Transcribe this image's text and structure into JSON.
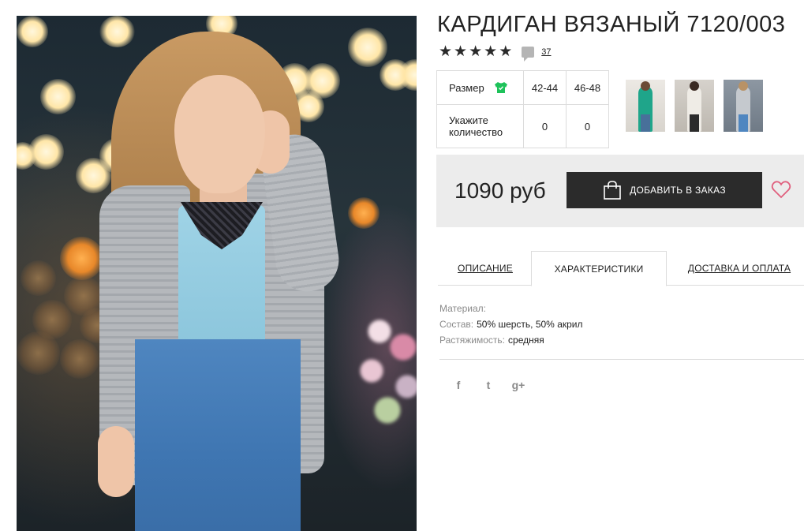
{
  "product": {
    "title": "КАРДИГАН ВЯЗАНЫЙ 7120/003",
    "rating_stars": 5,
    "review_count": "37",
    "price": "1090 руб"
  },
  "size_table": {
    "size_label": "Размер",
    "sizes": [
      "42-44",
      "46-48"
    ],
    "quantity_label": "Укажите количество",
    "quantities": [
      "0",
      "0"
    ]
  },
  "actions": {
    "add_to_order": "ДОБАВИТЬ В ЗАКАЗ"
  },
  "tabs": [
    {
      "label": "ОПИСАНИЕ",
      "active": false
    },
    {
      "label": "ХАРАКТЕРИСТИКИ",
      "active": true
    },
    {
      "label": "ДОСТАВКА И ОПЛАТА",
      "active": false
    }
  ],
  "specs": [
    {
      "key": "Материал:",
      "value": ""
    },
    {
      "key": "Состав:",
      "value": "50% шерсть, 50% акрил"
    },
    {
      "key": "Растяжимость:",
      "value": "средняя"
    }
  ],
  "social": {
    "facebook": "f",
    "twitter": "t",
    "googleplus": "g+"
  },
  "colors": {
    "accent_green": "#1ec25a",
    "heart_pink": "#e0607e",
    "button_dark": "#2b2b2b",
    "price_bar_bg": "#ececec"
  },
  "thumbnails": [
    {
      "name": "green-cardigan-variant",
      "color": "#1fa58a"
    },
    {
      "name": "white-cardigan-variant",
      "color": "#e6e4df"
    },
    {
      "name": "grey-cardigan-variant",
      "color": "#b8bcc2"
    }
  ]
}
